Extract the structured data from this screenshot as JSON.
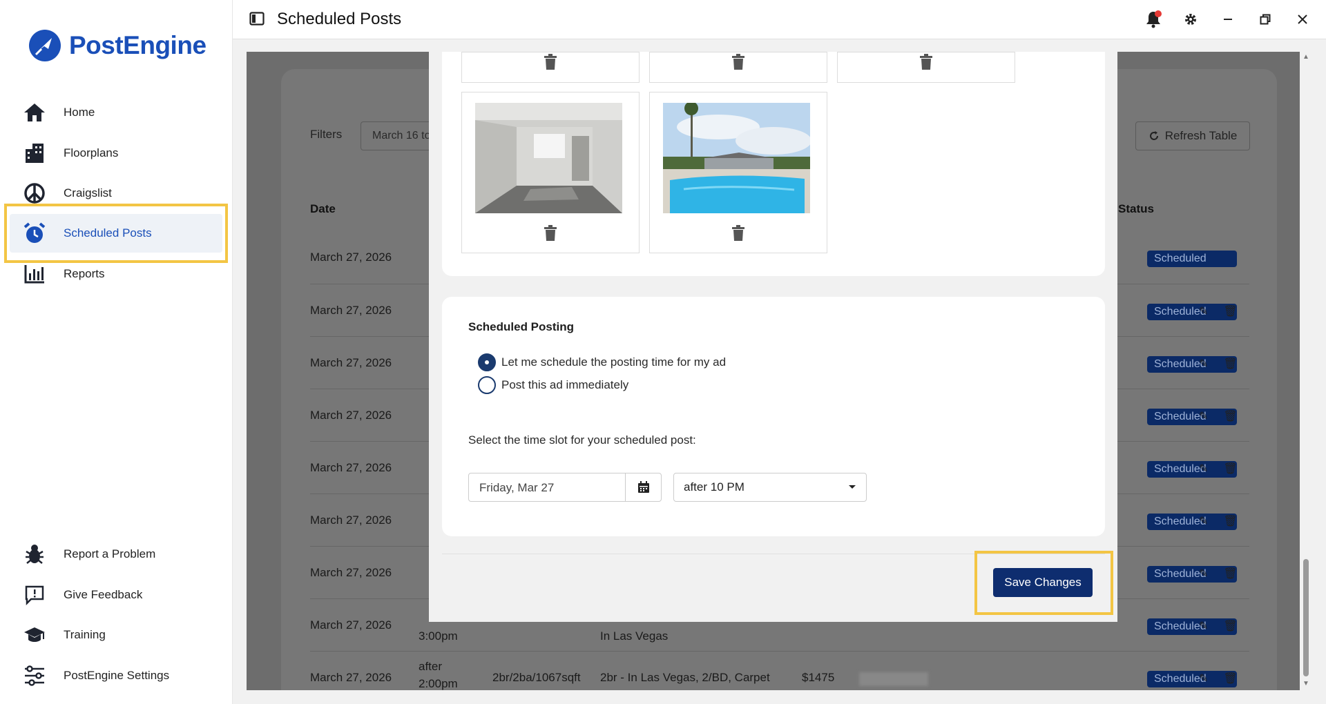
{
  "app": {
    "brand": "PostEngine",
    "window_title": "Scheduled Posts"
  },
  "sidebar": {
    "items": [
      {
        "label": "Home",
        "icon": "home-icon"
      },
      {
        "label": "Floorplans",
        "icon": "building-icon"
      },
      {
        "label": "Craigslist",
        "icon": "peace-icon"
      },
      {
        "label": "Scheduled Posts",
        "icon": "alarm-clock-icon",
        "active": true
      },
      {
        "label": "Reports",
        "icon": "bar-chart-icon"
      }
    ],
    "bottom_items": [
      {
        "label": "Report a Problem",
        "icon": "bug-icon"
      },
      {
        "label": "Give Feedback",
        "icon": "feedback-icon"
      },
      {
        "label": "Training",
        "icon": "graduation-cap-icon"
      },
      {
        "label": "PostEngine Settings",
        "icon": "sliders-icon"
      }
    ]
  },
  "background_table": {
    "filters_label": "Filters",
    "filter_value": "March 16 to",
    "refresh_label": "Refresh Table",
    "headers": {
      "date": "Date",
      "status": "Status"
    },
    "rows": [
      {
        "date": "March 27, 2026",
        "status": "Scheduled"
      },
      {
        "date": "March 27, 2026",
        "status": "Scheduled"
      },
      {
        "date": "March 27, 2026",
        "status": "Scheduled"
      },
      {
        "date": "March 27, 2026",
        "status": "Scheduled"
      },
      {
        "date": "March 27, 2026",
        "status": "Scheduled"
      },
      {
        "date": "March 27, 2026",
        "status": "Scheduled"
      },
      {
        "date": "March 27, 2026",
        "status": "Scheduled"
      },
      {
        "date": "March 27, 2026",
        "time": "3:00pm",
        "title": "In Las Vegas",
        "status": "Scheduled"
      },
      {
        "date": "March 27, 2026",
        "time_line1": "after",
        "time_line2": "2:00pm",
        "floorplan": "2br/2ba/1067sqft",
        "title": "2br - In Las Vegas, 2/BD, Carpet",
        "price": "$1475",
        "status": "Scheduled"
      }
    ]
  },
  "modal": {
    "scheduled_posting_title": "Scheduled Posting",
    "options": [
      {
        "label": "Let me schedule the posting time for my ad",
        "selected": true
      },
      {
        "label": "Post this ad immediately",
        "selected": false
      }
    ],
    "time_slot_label": "Select the time slot for your scheduled post:",
    "date_value": "Friday, Mar 27",
    "time_value": "after 10 PM",
    "save_label": "Save Changes"
  },
  "colors": {
    "brand": "#1a4fb8",
    "primary_button": "#0e2d6f",
    "highlight": "#f3c544",
    "notification": "#e53935"
  }
}
